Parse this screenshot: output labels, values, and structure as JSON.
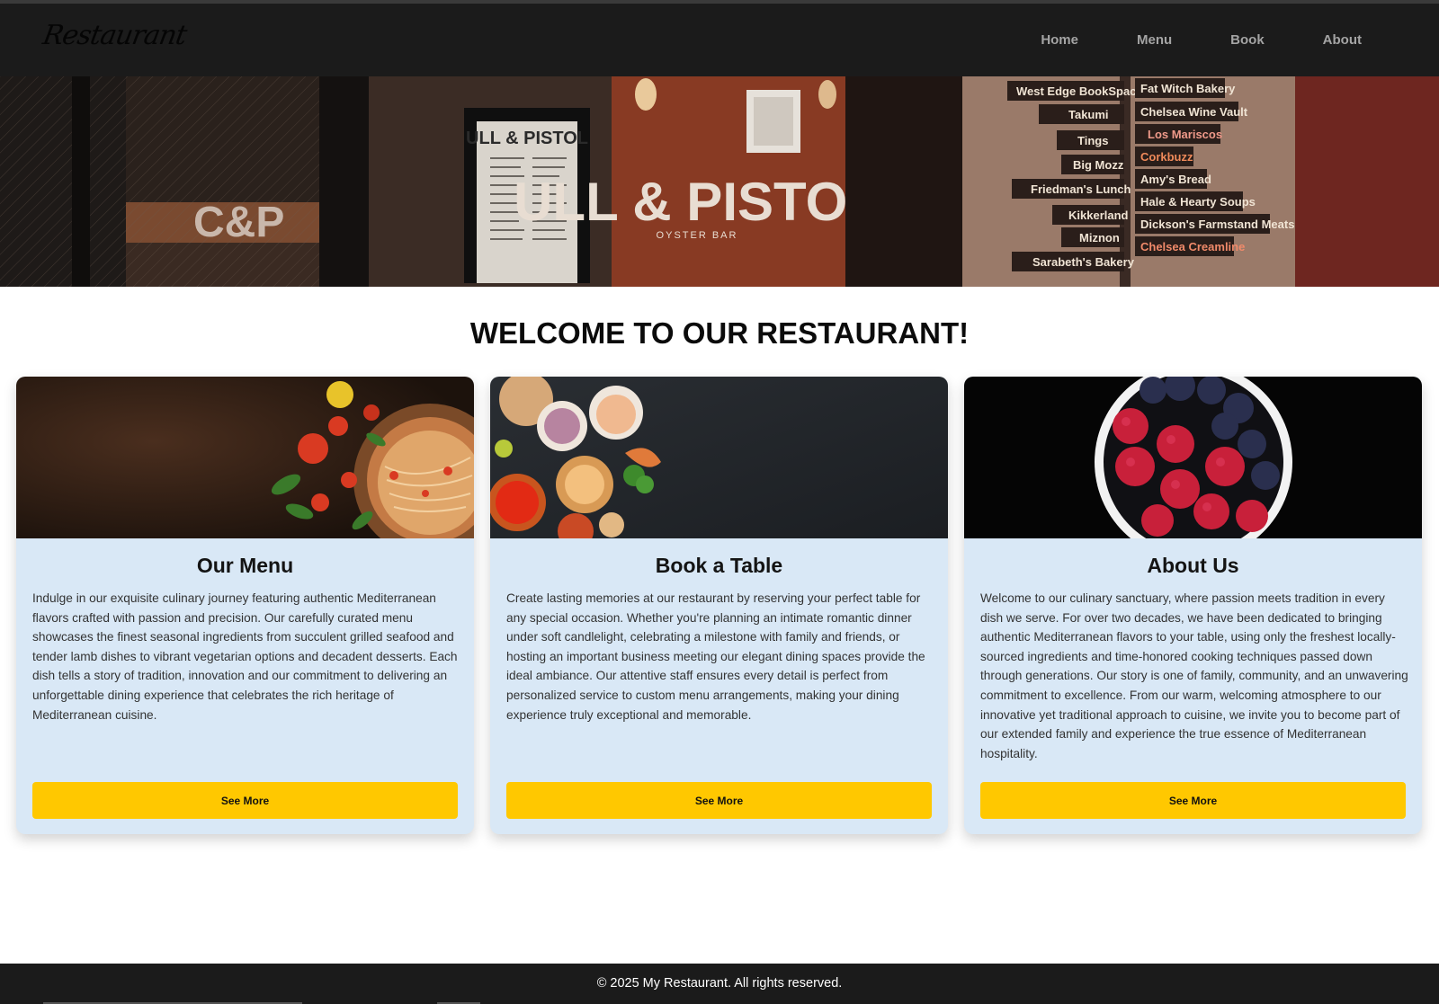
{
  "header": {
    "logo_text": "Restaurant",
    "nav": [
      "Home",
      "Menu",
      "Book",
      "About"
    ]
  },
  "hero": {
    "signs_left": [
      "West Edge BookSpace",
      "Takumi",
      "Tings",
      "Big Mozz",
      "Friedman's Lunch",
      "Kikkerland",
      "Miznon",
      "Sarabeth's Bakery"
    ],
    "signs_right": [
      "Fat Witch Bakery",
      "Chelsea Wine Vault",
      "Los Mariscos",
      "Corkbuzz",
      "Amy's Bread",
      "Hale & Hearty Soups",
      "Dickson's Farmstand Meats",
      "Chelsea Creamline"
    ],
    "window_text": "C&P",
    "bar_name": "ULL & PISTOL",
    "bar_subtitle": "OYSTER BAR",
    "menu_board_title": "ULL & PISTOL"
  },
  "main": {
    "title": "WELCOME TO OUR RESTAURANT!",
    "cards": [
      {
        "title": "Our Menu",
        "text": "Indulge in our exquisite culinary journey featuring authentic Mediterranean flavors crafted with passion and precision. Our carefully curated menu showcases the finest seasonal ingredients from succulent grilled seafood and tender lamb dishes to vibrant vegetarian options and decadent desserts. Each dish tells a story of tradition, innovation and our commitment to delivering an unforgettable dining experience that celebrates the rich heritage of Mediterranean cuisine.",
        "button": "See More"
      },
      {
        "title": "Book a Table",
        "text": "Create lasting memories at our restaurant by reserving your perfect table for any special occasion. Whether you're planning an intimate romantic dinner under soft candlelight, celebrating a milestone with family and friends, or hosting an important business meeting our elegant dining spaces provide the ideal ambiance. Our attentive staff ensures every detail is perfect from personalized service to custom menu arrangements, making your dining experience truly exceptional and memorable.",
        "button": "See More"
      },
      {
        "title": "About Us",
        "text": "Welcome to our culinary sanctuary, where passion meets tradition in every dish we serve. For over two decades, we have been dedicated to bringing authentic Mediterranean flavors to your table, using only the freshest locally-sourced ingredients and time-honored cooking techniques passed down through generations. Our story is one of family, community, and an unwavering commitment to excellence. From our warm, welcoming atmosphere to our innovative yet traditional approach to cuisine, we invite you to become part of our extended family and experience the true essence of Mediterranean hospitality.",
        "button": "See More"
      }
    ]
  },
  "footer": {
    "copyright": "© 2025 My Restaurant. All rights reserved."
  },
  "colors": {
    "header_bg": "#1b1b1b",
    "nav_text": "#a4a4a4",
    "card_bg": "#d9e8f6",
    "button_bg": "#ffc800"
  }
}
